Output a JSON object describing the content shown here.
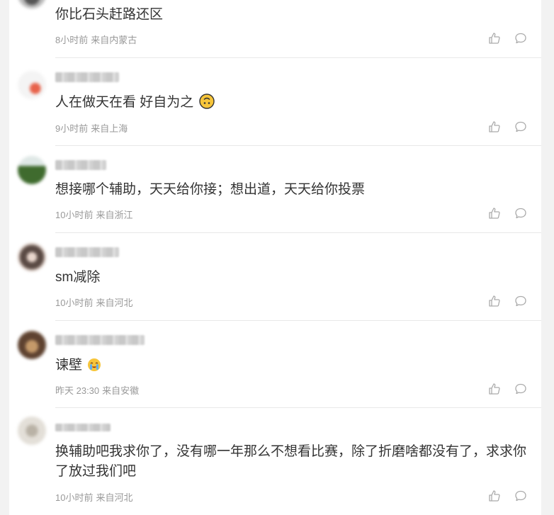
{
  "comments": [
    {
      "text": "你比石头赶路还区",
      "time": "8小时前",
      "location": "来自内蒙古",
      "emoji": ""
    },
    {
      "text": "人在做天在看 好自为之",
      "time": "9小时前",
      "location": "来自上海",
      "emoji": "upside-down-face"
    },
    {
      "text": "想接哪个辅助，天天给你接；想出道，天天给你投票",
      "time": "10小时前",
      "location": "来自浙江",
      "emoji": ""
    },
    {
      "text": "sm减除",
      "time": "10小时前",
      "location": "来自河北",
      "emoji": ""
    },
    {
      "text": "谏壁",
      "time": "昨天 23:30",
      "location": "来自安徽",
      "emoji": "crying-face"
    },
    {
      "text": "换辅助吧我求你了，没有哪一年那么不想看比赛，除了折磨啥都没有了，求求你了放过我们吧",
      "time": "10小时前",
      "location": "来自河北",
      "emoji": ""
    }
  ],
  "icons": {
    "like": "thumbs-up-icon",
    "reply": "speech-bubble-icon"
  },
  "colors": {
    "text": "#333333",
    "meta": "#999999",
    "divider": "#e8e8e8",
    "icon": "#aaaaaa"
  }
}
